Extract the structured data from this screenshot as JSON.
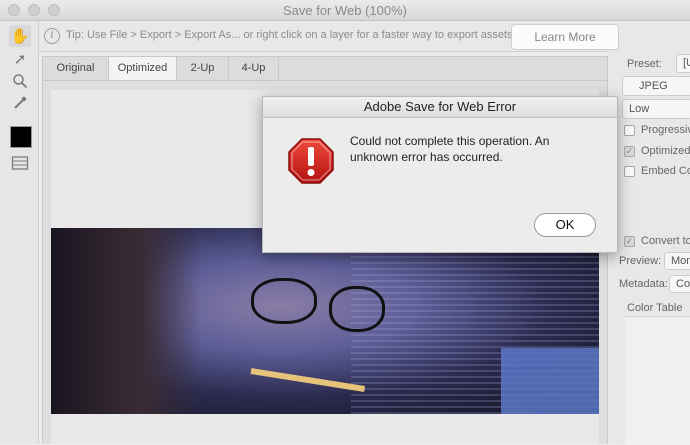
{
  "window": {
    "title": "Save for Web (100%)"
  },
  "tip": {
    "text": "Tip: Use File > Export > Export As...  or right click on a layer for a faster way to export assets",
    "learn_more": "Learn More"
  },
  "tabs": [
    {
      "label": "Original",
      "active": false
    },
    {
      "label": "Optimized",
      "active": true
    },
    {
      "label": "2-Up",
      "active": false
    },
    {
      "label": "4-Up",
      "active": false
    }
  ],
  "tools": [
    "hand-icon",
    "slice-select-icon",
    "zoom-icon",
    "eyedropper-icon",
    "color-swatch",
    "toggle-slices-icon"
  ],
  "swatch_color": "#000000",
  "right_panel": {
    "preset_label": "Preset:",
    "preset_value": "[Ur",
    "format_value": "JPEG",
    "quality_value": "Low",
    "progressive": "Progressive",
    "progressive_checked": false,
    "optimized": "Optimized",
    "optimized_checked": true,
    "embed": "Embed Co",
    "embed_checked": false,
    "convert": "Convert to",
    "convert_checked": true,
    "preview_label": "Preview:",
    "preview_value": "Mon",
    "metadata_label": "Metadata:",
    "metadata_value": "Co",
    "color_table_label": "Color Table"
  },
  "dialog": {
    "title": "Adobe Save for Web Error",
    "message": "Could not complete this operation. An unknown error has occurred.",
    "icon": "error-stop-icon",
    "icon_color": "#d0201b",
    "ok_label": "OK"
  }
}
